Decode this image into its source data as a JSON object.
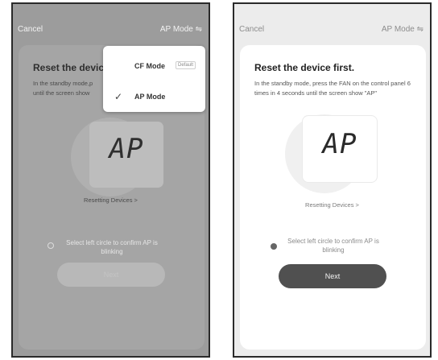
{
  "left_screen": {
    "cancel": "Cancel",
    "mode": "AP Mode ⇋",
    "title": "Reset the devic",
    "description": "In the standby mode,p until the screen show",
    "display_text": "AP",
    "resetting": "Resetting Devices >",
    "confirm": "Select left circle to confirm AP is blinking",
    "next": "Next",
    "menu": [
      {
        "label": "CF Mode",
        "badge": "Default",
        "checked": false
      },
      {
        "label": "AP Mode",
        "checked": true
      }
    ],
    "check_glyph": "✓"
  },
  "right_screen": {
    "cancel": "Cancel",
    "mode": "AP Mode ⇋",
    "title": "Reset the device first.",
    "description": "In the standby mode, press the FAN on the control panel 6 times in 4 seconds until the screen show \"AP\"",
    "display_text": "AP",
    "resetting": "Resetting Devices >",
    "confirm": "Select left circle to confirm AP is blinking",
    "next": "Next"
  }
}
